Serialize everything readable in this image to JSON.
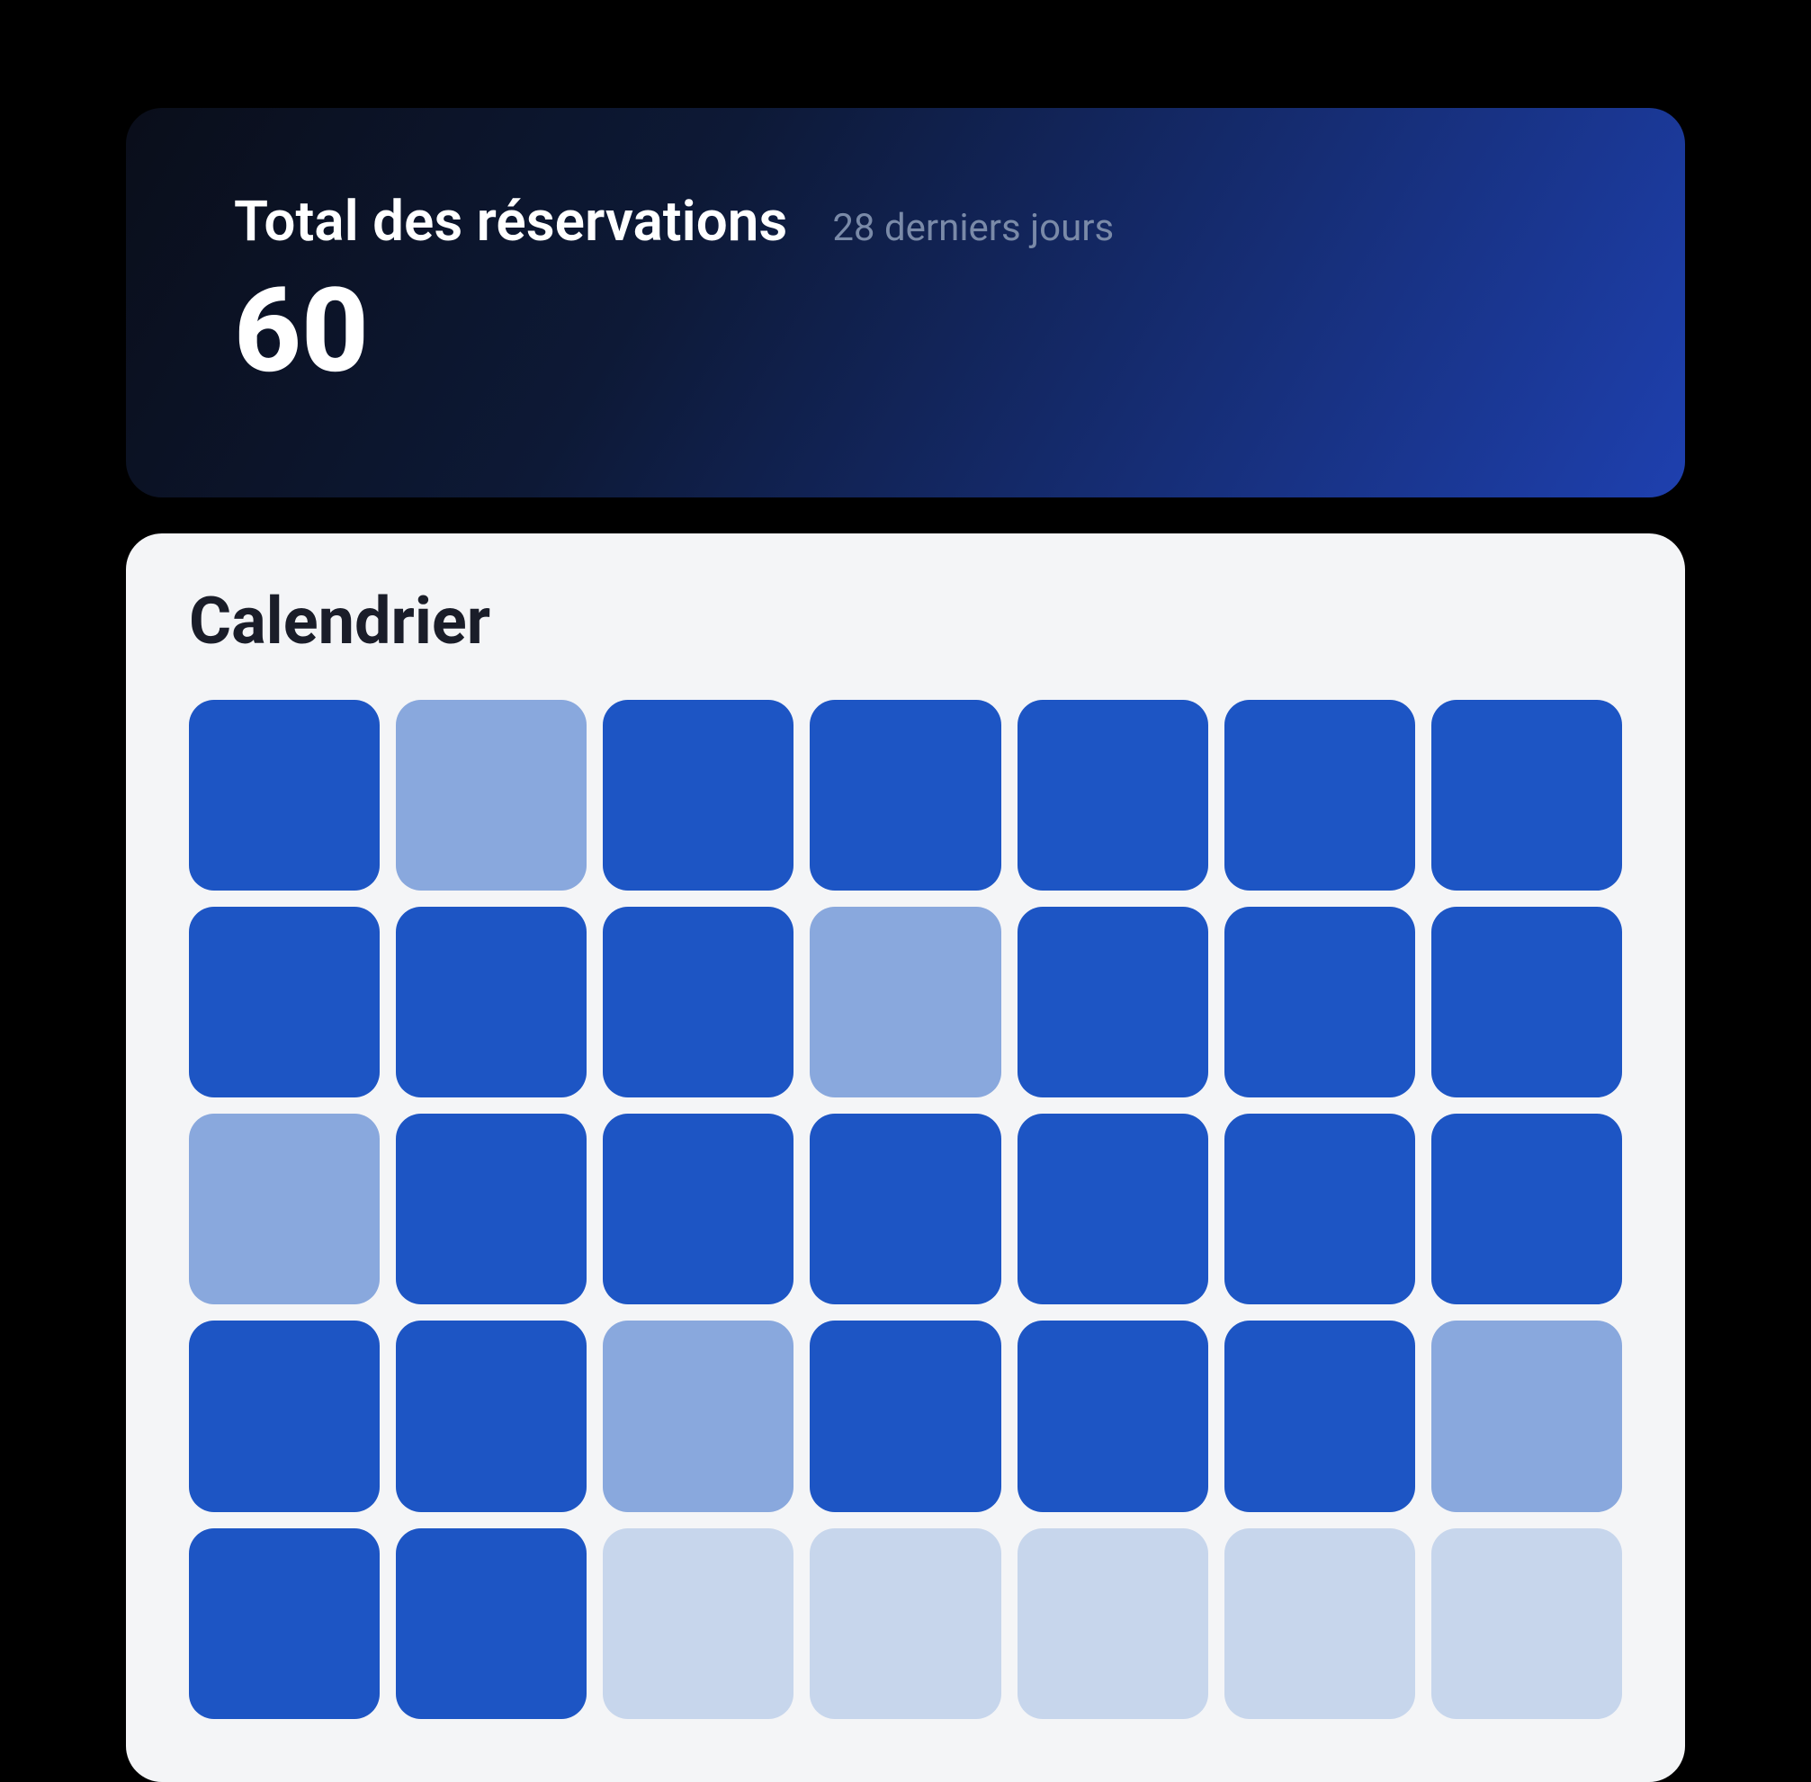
{
  "stat": {
    "title": "Total des réservations",
    "subtitle": "28 derniers jours",
    "value": "60"
  },
  "calendar": {
    "title": "Calendrier",
    "cells": [
      "full",
      "medium",
      "full",
      "full",
      "full",
      "full",
      "full",
      "full",
      "full",
      "full",
      "medium",
      "full",
      "full",
      "full",
      "medium",
      "full",
      "full",
      "full",
      "full",
      "full",
      "full",
      "full",
      "full",
      "medium",
      "full",
      "full",
      "full",
      "medium",
      "full",
      "full",
      "light",
      "light",
      "light",
      "light",
      "light"
    ]
  },
  "colors": {
    "full": "#1d55c4",
    "medium": "#89a8dd",
    "light": "#c7d6ec"
  }
}
